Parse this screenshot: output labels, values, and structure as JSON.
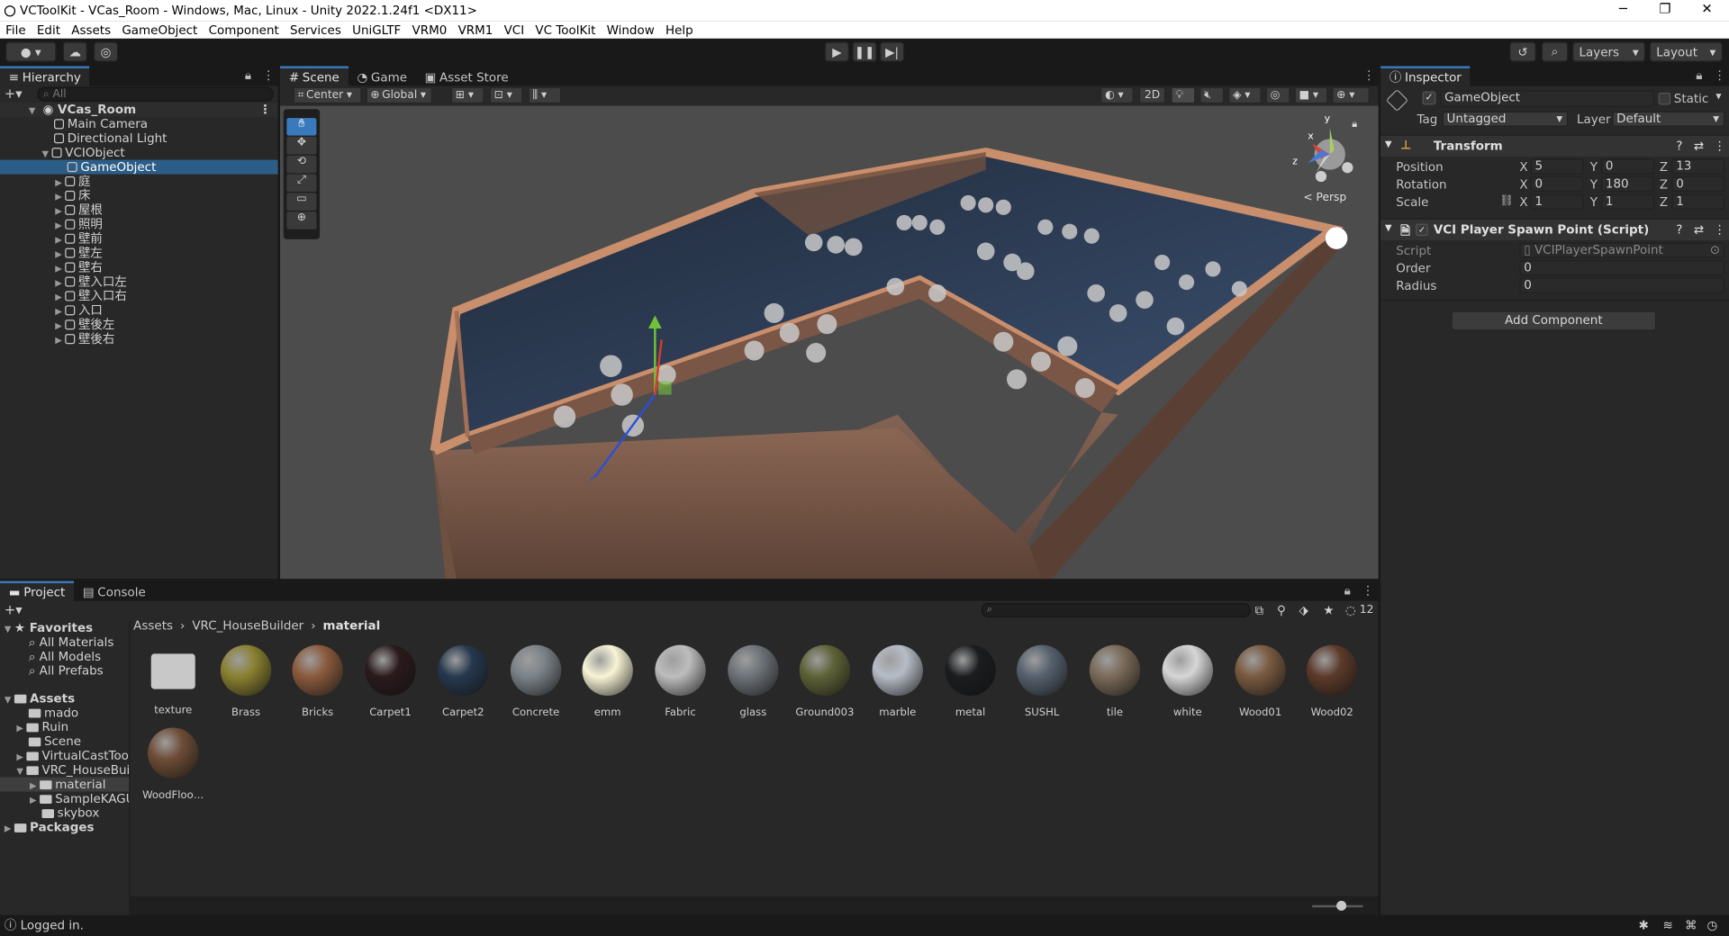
{
  "window": {
    "title": "VCToolKit - VCas_Room - Windows, Mac, Linux - Unity 2022.1.24f1 <DX11>",
    "minimize": "─",
    "maximize": "❐",
    "close": "✕"
  },
  "menu": [
    "File",
    "Edit",
    "Assets",
    "GameObject",
    "Component",
    "Services",
    "UniGLTF",
    "VRM0",
    "VRM1",
    "VCI",
    "VC ToolKit",
    "Window",
    "Help"
  ],
  "toolbar": {
    "layers_label": "Layers",
    "layout_label": "Layout"
  },
  "hierarchy": {
    "tab": "Hierarchy",
    "search_placeholder": "All",
    "scene_name": "VCas_Room",
    "items": [
      {
        "label": "Main Camera"
      },
      {
        "label": "Directional Light"
      },
      {
        "label": "VCIObject"
      },
      {
        "label": "GameObject"
      },
      {
        "label": "庭"
      },
      {
        "label": "床"
      },
      {
        "label": "屋根"
      },
      {
        "label": "照明"
      },
      {
        "label": "壁前"
      },
      {
        "label": "壁左"
      },
      {
        "label": "壁右"
      },
      {
        "label": "壁入口左"
      },
      {
        "label": "壁入口右"
      },
      {
        "label": "入口"
      },
      {
        "label": "壁後左"
      },
      {
        "label": "壁後右"
      }
    ]
  },
  "scene": {
    "tabs": [
      "Scene",
      "Game",
      "Asset Store"
    ],
    "pivot": "Center",
    "space": "Global",
    "mode_2d": "2D",
    "persp_label": "< Persp",
    "gizmo_x": "x",
    "gizmo_y": "y",
    "gizmo_z": "z"
  },
  "inspector": {
    "tab": "Inspector",
    "object_name": "GameObject",
    "static_label": "Static",
    "tag_label": "Tag",
    "tag_value": "Untagged",
    "layer_label": "Layer",
    "layer_value": "Default",
    "transform": {
      "title": "Transform",
      "position_label": "Position",
      "rotation_label": "Rotation",
      "scale_label": "Scale",
      "position": {
        "x": "5",
        "y": "0",
        "z": "13"
      },
      "rotation": {
        "x": "0",
        "y": "180",
        "z": "0"
      },
      "scale": {
        "x": "1",
        "y": "1",
        "z": "1"
      }
    },
    "script_component": {
      "title": "VCI Player Spawn Point (Script)",
      "script_label": "Script",
      "script_value": "VCIPlayerSpawnPoint",
      "order_label": "Order",
      "order_value": "0",
      "radius_label": "Radius",
      "radius_value": "0"
    },
    "add_component": "Add Component"
  },
  "project": {
    "tabs": [
      "Project",
      "Console"
    ],
    "hidden_count": "12",
    "breadcrumb": [
      "Assets",
      "VRC_HouseBuilder",
      "material"
    ],
    "favorites_label": "Favorites",
    "favorites": [
      "All Materials",
      "All Models",
      "All Prefabs"
    ],
    "assets_label": "Assets",
    "asset_tree": [
      "mado",
      "Ruin",
      "Scene",
      "VirtualCastToolK",
      "VRC_HouseBuild",
      "material",
      "SampleKAGU",
      "skybox"
    ],
    "packages_label": "Packages",
    "assets": [
      {
        "name": "texture",
        "color": "#c8c8c8"
      },
      {
        "name": "Brass",
        "color": "#8a8030"
      },
      {
        "name": "Bricks",
        "color": "#8a5a3c"
      },
      {
        "name": "Carpet1",
        "color": "#2a1a1c"
      },
      {
        "name": "Carpet2",
        "color": "#26384e"
      },
      {
        "name": "Concrete",
        "color": "#7a8288"
      },
      {
        "name": "emm",
        "color": "#f8f4d6"
      },
      {
        "name": "Fabric",
        "color": "#bdbdbd"
      },
      {
        "name": "glass",
        "color": "#6c7278"
      },
      {
        "name": "Ground003",
        "color": "#5e6236"
      },
      {
        "name": "marble",
        "color": "#b6bcc6"
      },
      {
        "name": "metal",
        "color": "#1a1c1e"
      },
      {
        "name": "SUSHL",
        "color": "#56616e"
      },
      {
        "name": "tile",
        "color": "#7a6a58"
      },
      {
        "name": "white",
        "color": "#d6d6d6"
      },
      {
        "name": "Wood01",
        "color": "#7a5a40"
      },
      {
        "name": "Wood02",
        "color": "#5c3a2a"
      },
      {
        "name": "WoodFloo…",
        "color": "#6e4c36"
      }
    ]
  },
  "status": {
    "text": "Logged in."
  },
  "colors": {
    "selection": "#2c5d87",
    "tab_accent": "#3a79bb",
    "panel_bg": "#282828"
  }
}
